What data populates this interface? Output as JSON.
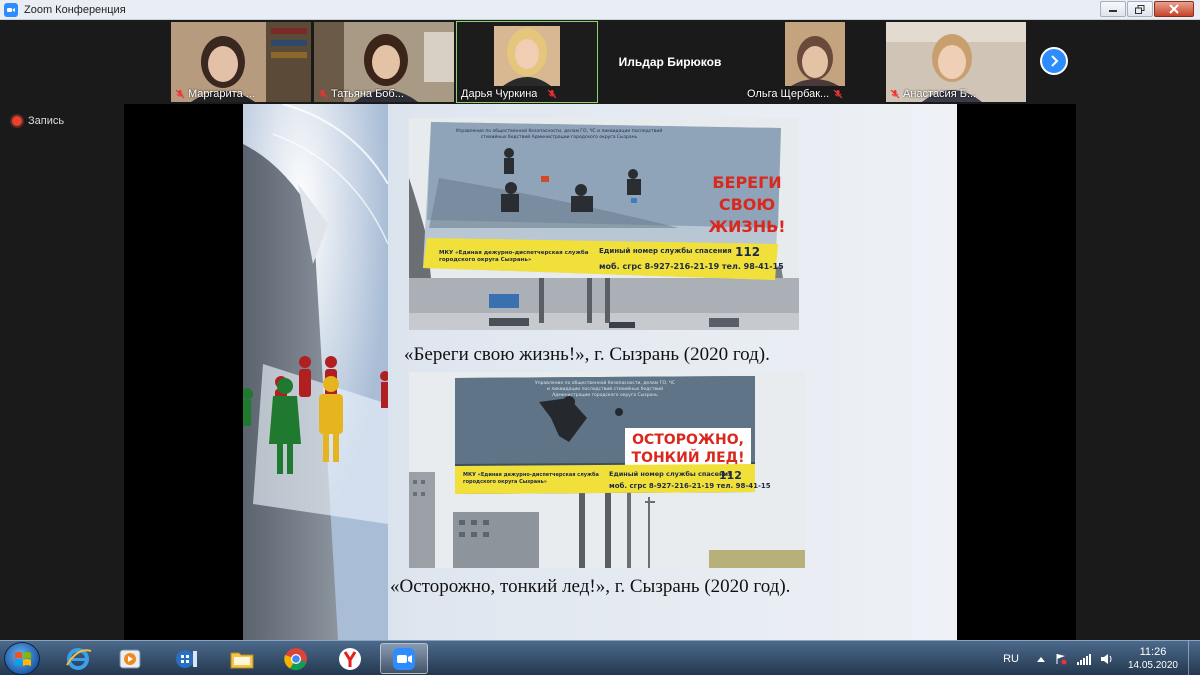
{
  "window": {
    "title": "Zoom Конференция"
  },
  "participants": [
    {
      "name": "Маргарита ..."
    },
    {
      "name": "Татьяна Боб..."
    },
    {
      "name": "Дарья Чуркина"
    },
    {
      "name": "Ильдар Бирюков"
    },
    {
      "name": "Ольга Щербак..."
    },
    {
      "name": "Анастасия Б..."
    }
  ],
  "recording": {
    "label": "Запись"
  },
  "slide": {
    "billboard1": {
      "header": "Управление по общественной безопасности, делам ГО, ЧС и ликвидации последствий стихийных бедствий Администрации городского округа Сызрань",
      "headline": "БЕРЕГИ СВОЮ ЖИЗНЬ!",
      "service": "МКУ «Единая дежурно-диспетчерская служба городского округа Сызрань»",
      "phone_label": "Единый номер службы спасения",
      "phone_main": "112",
      "phone_extra": "моб. сгрс 8-927-216-21-19 тел. 98-41-15"
    },
    "caption1": "«Береги свою жизнь!», г. Сызрань (2020 год).",
    "billboard2": {
      "header": "Управление по общественной безопасности, делам ГО, ЧС и ликвидации последствий стихийных бедствий Администрации городского округа Сызрань",
      "headline": "ОСТОРОЖНО, ТОНКИЙ ЛЕД!",
      "service": "МКУ «Единая дежурно-диспетчерская служба городского округа Сызрань»",
      "phone_label": "Единый номер службы спасения",
      "phone_main": "112",
      "phone_extra": "моб. сгрс 8-927-216-21-19 тел. 98-41-15"
    },
    "caption2": "«Осторожно, тонкий лед!», г. Сызрань (2020 год)."
  },
  "taskbar": {
    "apps": [
      "internet-explorer",
      "media-player",
      "media-center",
      "file-explorer",
      "google-chrome",
      "yandex-browser",
      "zoom"
    ],
    "language": "RU",
    "time": "11:26",
    "date": "14.05.2020"
  },
  "colors": {
    "zoom_blue": "#2d8cff",
    "record_red": "#e8432d",
    "billboard_yellow": "#f2e03a",
    "billboard_red": "#d9281e"
  }
}
